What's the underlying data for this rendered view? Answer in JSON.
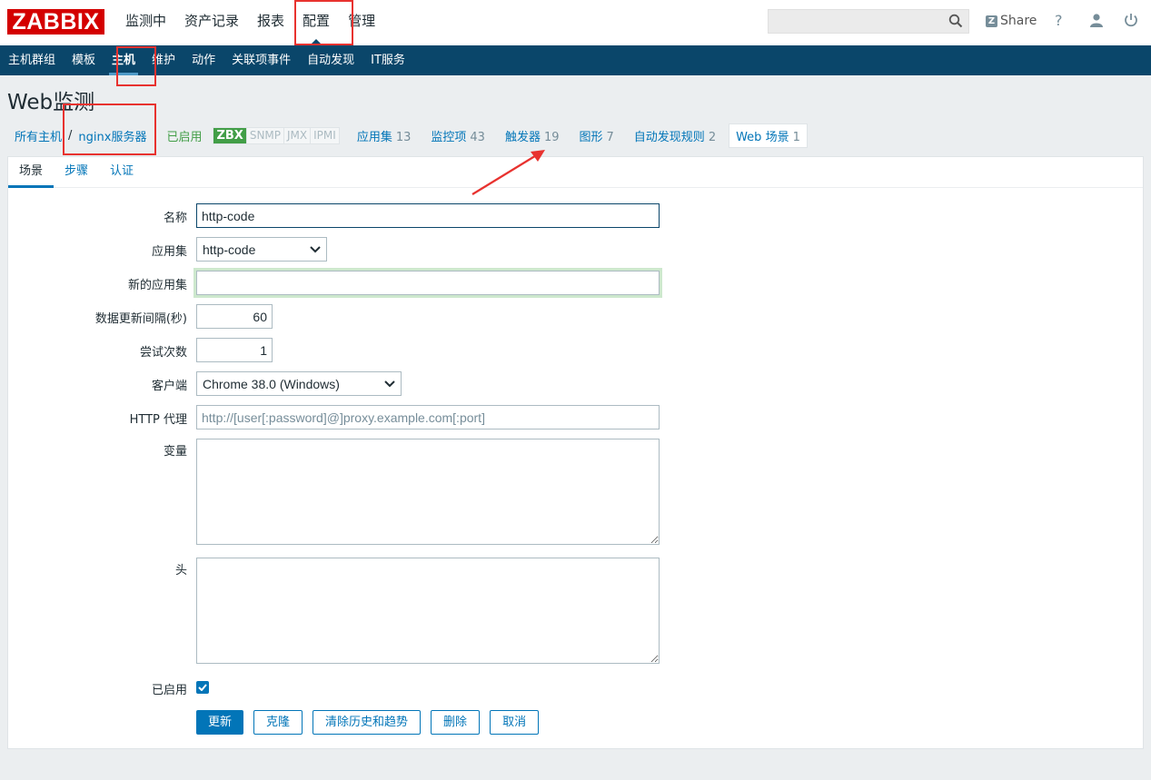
{
  "header": {
    "logo": "ZABBIX",
    "menu": [
      "监测中",
      "资产记录",
      "报表",
      "配置",
      "管理"
    ],
    "active_menu": "配置",
    "search_placeholder": "",
    "share_label": "Share",
    "help_label": "?"
  },
  "submenu": {
    "items": [
      "主机群组",
      "模板",
      "主机",
      "维护",
      "动作",
      "关联项事件",
      "自动发现",
      "IT服务"
    ],
    "active": "主机"
  },
  "page": {
    "title": "Web监测"
  },
  "breadcrumb": {
    "all_hosts": "所有主机",
    "separator": "/",
    "host": "nginx服务器",
    "status": "已启用",
    "availability": [
      "ZBX",
      "SNMP",
      "JMX",
      "IPMI"
    ],
    "links": [
      {
        "label": "应用集",
        "count": "13"
      },
      {
        "label": "监控项",
        "count": "43"
      },
      {
        "label": "触发器",
        "count": "19"
      },
      {
        "label": "图形",
        "count": "7"
      },
      {
        "label": "自动发现规则",
        "count": "2"
      }
    ],
    "current": {
      "label": "Web 场景",
      "count": "1"
    }
  },
  "tabs": [
    "场景",
    "步骤",
    "认证"
  ],
  "form": {
    "name_label": "名称",
    "name_value": "http-code",
    "app_label": "应用集",
    "app_value": "http-code",
    "new_app_label": "新的应用集",
    "new_app_value": "",
    "interval_label": "数据更新间隔(秒)",
    "interval_value": "60",
    "attempts_label": "尝试次数",
    "attempts_value": "1",
    "agent_label": "客户端",
    "agent_value": "Chrome 38.0 (Windows)",
    "proxy_label": "HTTP 代理",
    "proxy_placeholder": "http://[user[:password]@]proxy.example.com[:port]",
    "variables_label": "变量",
    "headers_label": "头",
    "enabled_label": "已启用",
    "enabled": true
  },
  "buttons": {
    "update": "更新",
    "clone": "克隆",
    "clear": "清除历史和趋势",
    "delete": "删除",
    "cancel": "取消"
  },
  "colors": {
    "brand": "#d40000",
    "nav": "#0a466a",
    "link": "#0275b8",
    "enabled": "#429e47",
    "annotation": "#e8322f"
  }
}
